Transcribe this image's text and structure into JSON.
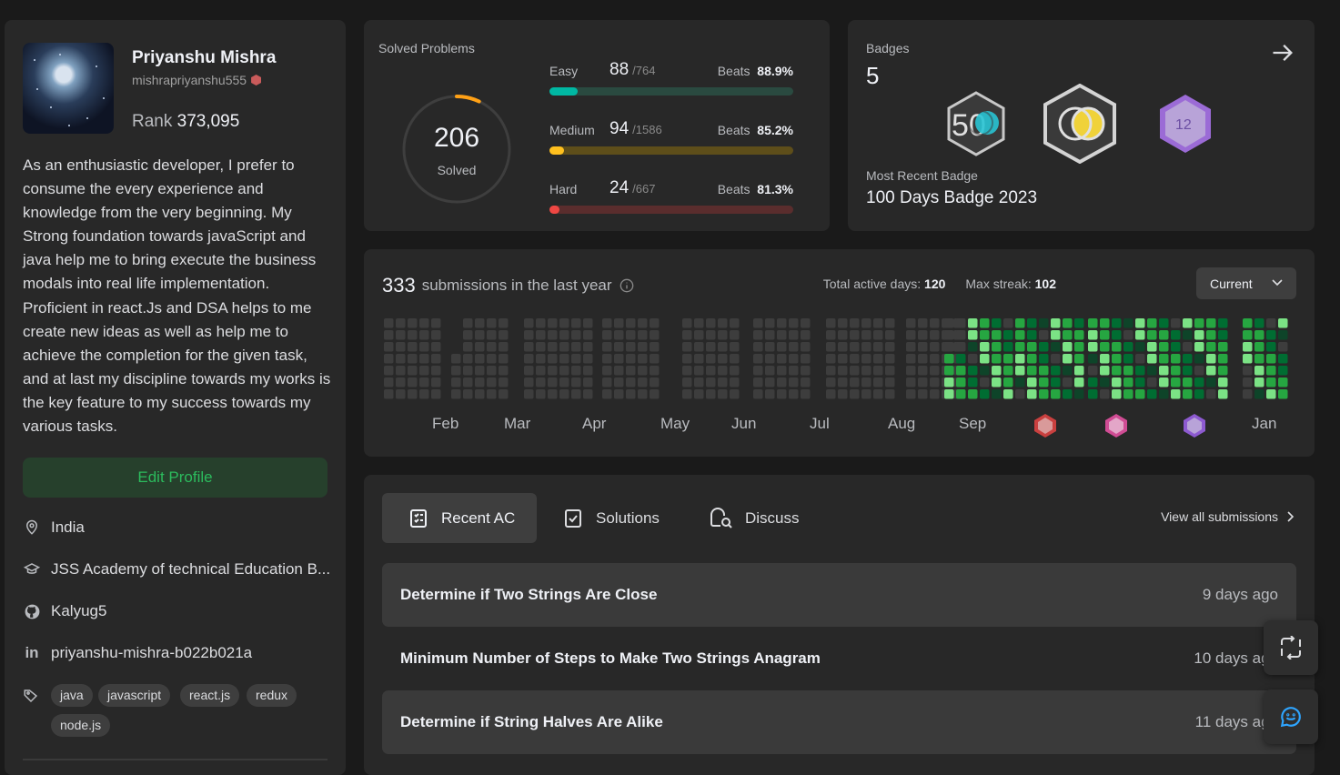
{
  "profile": {
    "name": "Priyanshu Mishra",
    "username": "mishrapriyanshu555",
    "rank_label": "Rank",
    "rank_value": "373,095",
    "bio": "As an enthusiastic developer, I prefer to consume the every experience and knowledge from the very beginning. My Strong foundation towards javaScript and java help me to bring execute the business modals into real life implementation. Proficient in react.Js and DSA helps to me create new ideas as well as help me to achieve the completion for the given task, and at last my discipline towards my works is the key feature to my success towards my various tasks.",
    "edit_label": "Edit Profile",
    "location": "India",
    "school": "JSS Academy of technical Education B...",
    "github": "Kalyug5",
    "linkedin": "priyanshu-mishra-b022b021a",
    "skills": [
      "java",
      "javascript",
      "react.js",
      "redux",
      "node.js"
    ]
  },
  "solved": {
    "title": "Solved Problems",
    "total": "206",
    "total_label": "Solved",
    "levels": [
      {
        "name": "Easy",
        "count": "88",
        "total": "/764",
        "beats_label": "Beats",
        "beats": "88.9%",
        "fraction": 0.115,
        "color": "#00b8a3",
        "track": "#2a4a40"
      },
      {
        "name": "Medium",
        "count": "94",
        "total": "/1586",
        "beats_label": "Beats",
        "beats": "85.2%",
        "fraction": 0.059,
        "color": "#ffc01e",
        "track": "#5e4e1a"
      },
      {
        "name": "Hard",
        "count": "24",
        "total": "/667",
        "beats_label": "Beats",
        "beats": "81.3%",
        "fraction": 0.036,
        "color": "#ef4743",
        "track": "#5a2d2d"
      }
    ]
  },
  "badges": {
    "title": "Badges",
    "count": "5",
    "recent_label": "Most Recent Badge",
    "recent_name": "100 Days Badge 2023",
    "items": [
      {
        "icon": "50-days-badge-icon",
        "text": "50"
      },
      {
        "icon": "100-days-badge-icon",
        "text": "100"
      },
      {
        "icon": "dec-12-badge-icon",
        "text": "12"
      }
    ]
  },
  "calendar": {
    "count": "333",
    "label": "submissions in the last year",
    "active_label": "Total active days:",
    "active_value": "120",
    "streak_label": "Max streak:",
    "streak_value": "102",
    "select": "Current",
    "months": [
      "Feb",
      "Mar",
      "Apr",
      "May",
      "Jun",
      "Jul",
      "Aug",
      "Sep",
      "Jan"
    ],
    "colors": {
      "empty": "#3d3d3d",
      "l1": "#0e4429",
      "l2": "#006d32",
      "l3": "#26a641",
      "l4": "#7be285"
    }
  },
  "recent": {
    "tabs": [
      {
        "label": "Recent AC",
        "icon": "recent-ac-icon"
      },
      {
        "label": "Solutions",
        "icon": "solutions-icon"
      },
      {
        "label": "Discuss",
        "icon": "discuss-icon"
      }
    ],
    "view_all": "View all submissions",
    "rows": [
      {
        "title": "Determine if Two Strings Are Close",
        "time": "9 days ago"
      },
      {
        "title": "Minimum Number of Steps to Make Two Strings Anagram",
        "time": "10 days ago"
      },
      {
        "title": "Determine if String Halves Are Alike",
        "time": "11 days ago"
      }
    ]
  }
}
